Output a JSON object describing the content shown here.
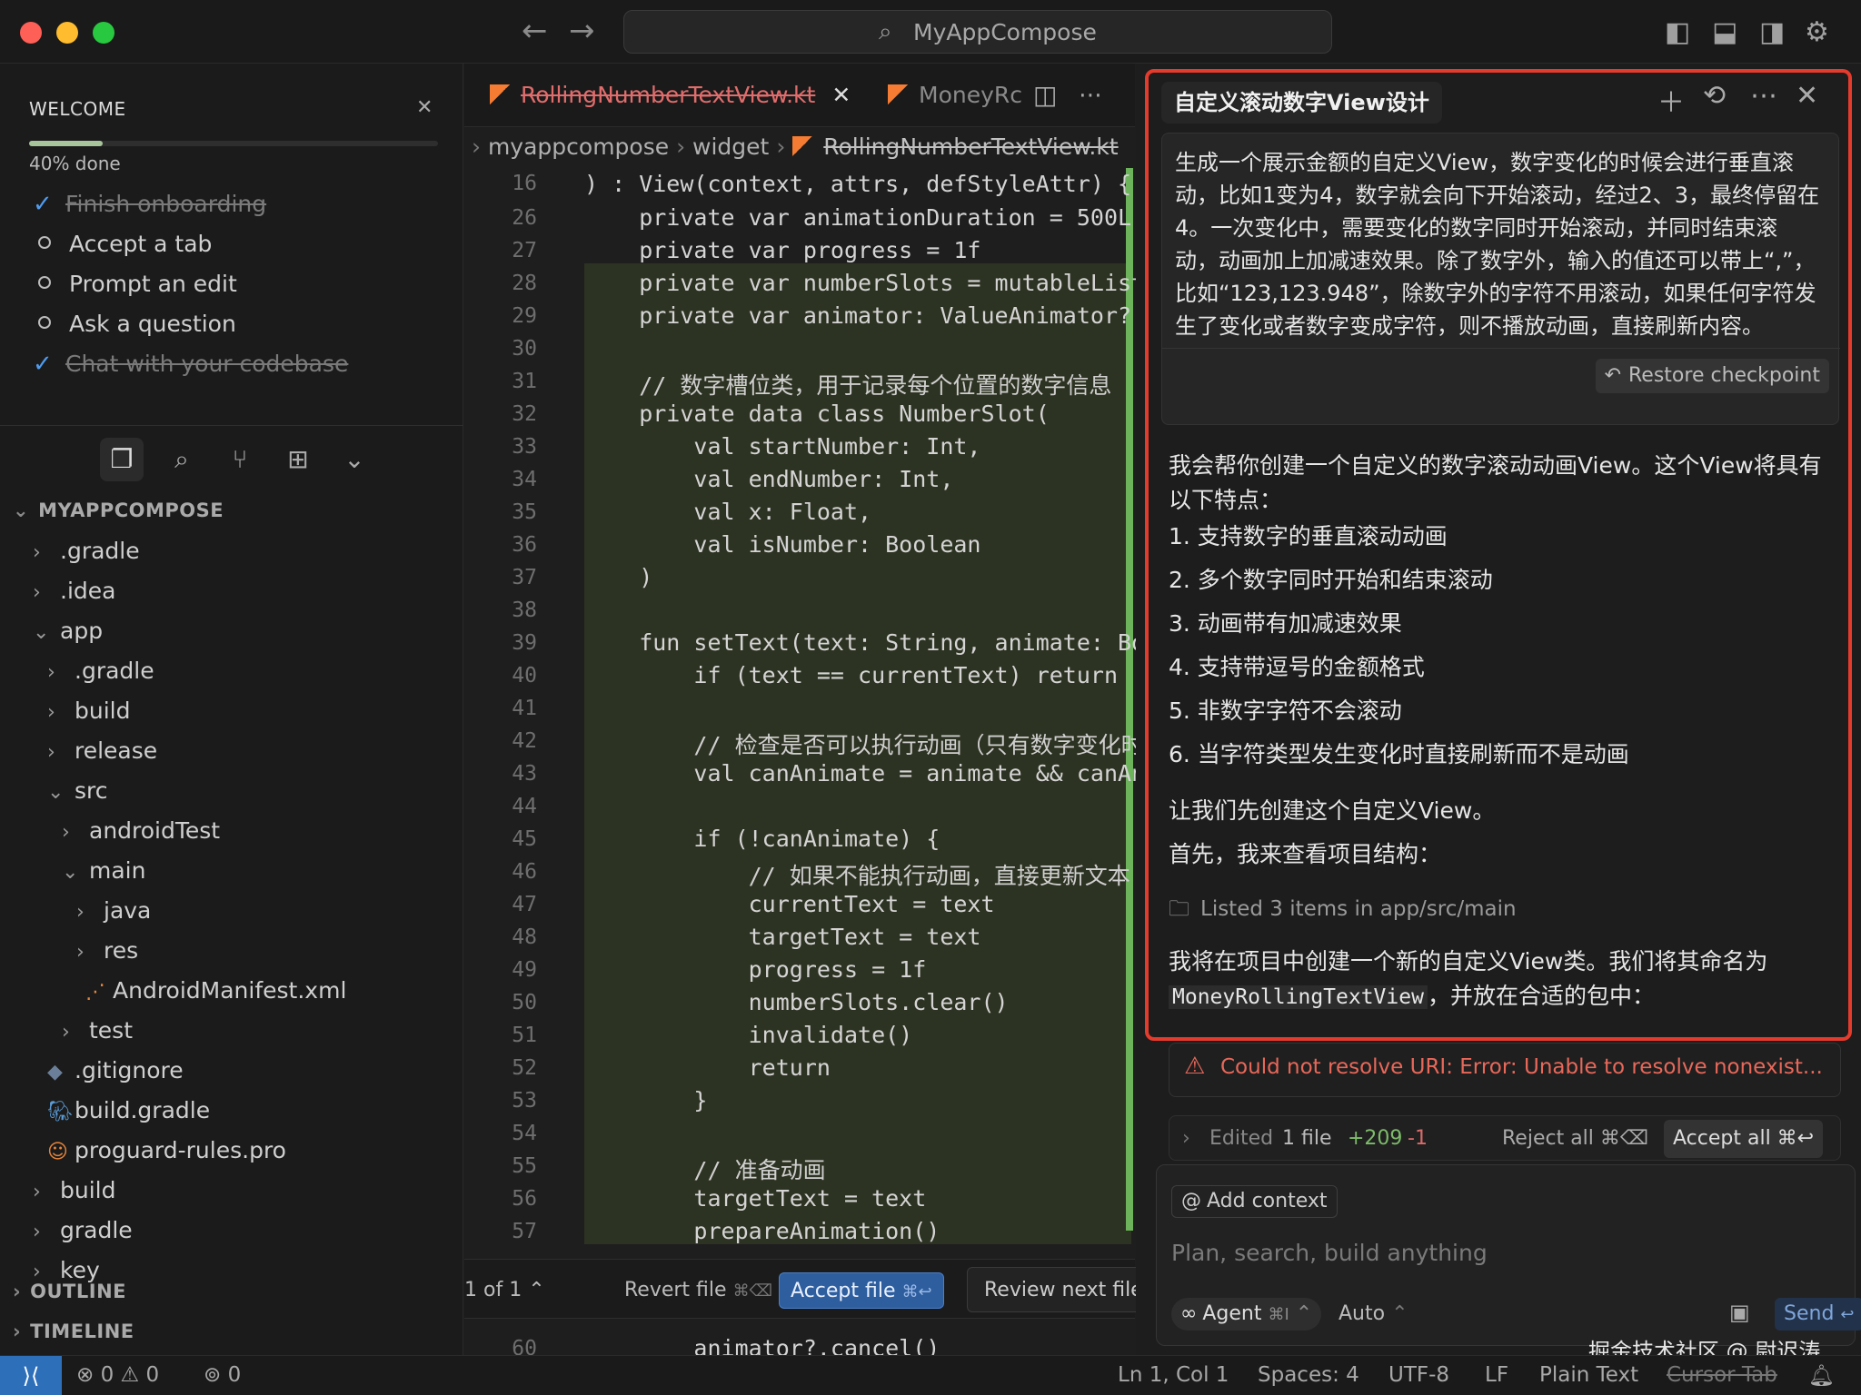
{
  "window": {
    "search": "MyAppCompose"
  },
  "welcome": {
    "title": "WELCOME",
    "progress_percent": 40,
    "progress_text": "40% done",
    "tasks": [
      {
        "label": "Finish onboarding",
        "done": true
      },
      {
        "label": "Accept a tab",
        "done": false
      },
      {
        "label": "Prompt an edit",
        "done": false
      },
      {
        "label": "Ask a question",
        "done": false
      },
      {
        "label": "Chat with your codebase",
        "done": true
      }
    ]
  },
  "explorer": {
    "root": "MYAPPCOMPOSE",
    "items": [
      ".gradle",
      ".idea",
      "app",
      ".gradle",
      "build",
      "release",
      "src",
      "androidTest",
      "main",
      "java",
      "res",
      "AndroidManifest.xml",
      "test",
      ".gitignore",
      "build.gradle",
      "proguard-rules.pro",
      "build",
      "gradle",
      "key"
    ],
    "outline": "OUTLINE",
    "timeline": "TIMELINE"
  },
  "editor": {
    "tabs": [
      "RollingNumberTextView.kt",
      "MoneyRc"
    ],
    "breadcrumb": [
      "myappcompose",
      "widget",
      "RollingNumberTextView.kt"
    ],
    "sticky": {
      "num": "16",
      "text": ") : View(context, attrs, defStyleAttr) {"
    },
    "lines": [
      {
        "num": "26",
        "text": "    private var animationDuration = 500L"
      },
      {
        "num": "27",
        "text": "    private var progress = 1f"
      },
      {
        "num": "28",
        "text": "    private var numberSlots = mutableList"
      },
      {
        "num": "29",
        "text": "    private var animator: ValueAnimator? ="
      },
      {
        "num": "30",
        "text": ""
      },
      {
        "num": "31",
        "text": "    // 数字槽位类，用于记录每个位置的数字信息"
      },
      {
        "num": "32",
        "text": "    private data class NumberSlot("
      },
      {
        "num": "33",
        "text": "        val startNumber: Int,"
      },
      {
        "num": "34",
        "text": "        val endNumber: Int,"
      },
      {
        "num": "35",
        "text": "        val x: Float,"
      },
      {
        "num": "36",
        "text": "        val isNumber: Boolean"
      },
      {
        "num": "37",
        "text": "    )"
      },
      {
        "num": "38",
        "text": ""
      },
      {
        "num": "39",
        "text": "    fun setText(text: String, animate: Boo"
      },
      {
        "num": "40",
        "text": "        if (text == currentText) return"
      },
      {
        "num": "41",
        "text": ""
      },
      {
        "num": "42",
        "text": "        // 检查是否可以执行动画（只有数字变化时"
      },
      {
        "num": "43",
        "text": "        val canAnimate = animate && canAni"
      },
      {
        "num": "44",
        "text": ""
      },
      {
        "num": "45",
        "text": "        if (!canAnimate) {"
      },
      {
        "num": "46",
        "text": "            // 如果不能执行动画，直接更新文本"
      },
      {
        "num": "47",
        "text": "            currentText = text"
      },
      {
        "num": "48",
        "text": "            targetText = text"
      },
      {
        "num": "49",
        "text": "            progress = 1f"
      },
      {
        "num": "50",
        "text": "            numberSlots.clear()"
      },
      {
        "num": "51",
        "text": "            invalidate()"
      },
      {
        "num": "52",
        "text": "            return"
      },
      {
        "num": "53",
        "text": "        }"
      },
      {
        "num": "54",
        "text": ""
      },
      {
        "num": "55",
        "text": "        // 准备动画"
      },
      {
        "num": "56",
        "text": "        targetText = text"
      },
      {
        "num": "57",
        "text": "        prepareAnimation()"
      }
    ],
    "last_line": {
      "num": "60",
      "text": "        animator?.cancel()"
    },
    "review": {
      "count": "1 of 1",
      "revert": "Revert file",
      "revert_kbd": "⌘⌫",
      "accept": "Accept file",
      "accept_kbd": "⌘↩",
      "next": "Review next file"
    }
  },
  "chat": {
    "title": "自定义滚动数字View设计",
    "user_message": "生成一个展示金额的自定义View，数字变化的时候会进行垂直滚动，比如1变为4，数字就会向下开始滚动，经过2、3，最终停留在4。一次变化中，需要变化的数字同时开始滚动，并同时结束滚动，动画加上加减速效果。除了数字外，输入的值还可以带上“,”，比如“123,123.948”，除数字外的字符不用滚动，如果任何字符发生了变化或者数字变成字符，则不播放动画，直接刷新内容。",
    "restore": "Restore checkpoint",
    "intro": "我会帮你创建一个自定义的数字滚动动画View。这个View将具有以下特点：",
    "features": [
      "1. 支持数字的垂直滚动动画",
      "2. 多个数字同时开始和结束滚动",
      "3. 动画带有加减速效果",
      "4. 支持带逗号的金额格式",
      "5. 非数字字符不会滚动",
      "6. 当字符类型发生变化时直接刷新而不是动画"
    ],
    "p1": "让我们先创建这个自定义View。",
    "p2": "首先，我来查看项目结构：",
    "listed": "Listed 3 items in app/src/main",
    "p3_a": "我将在项目中创建一个新的自定义View类。我们将其命名为",
    "p3_code": "MoneyRollingTextView",
    "p3_b": "，并放在合适的包中：",
    "error": "Could not resolve URI: Error: Unable to resolve nonexist...",
    "edited": {
      "label": "Edited",
      "files": "1 file",
      "added": "+209",
      "removed": "-1",
      "reject": "Reject all ⌘⌫",
      "accept": "Accept all ⌘↩"
    },
    "add_context": "Add context",
    "placeholder": "Plan, search, build anything",
    "agent": "Agent",
    "agent_kbd": "⌘I",
    "auto": "Auto",
    "send": "Send"
  },
  "watermark": "掘金技术社区 @ 尉迟涛",
  "status": {
    "errors": "0",
    "warnings": "0",
    "ports": "0",
    "position": "Ln 1, Col 1",
    "spaces": "Spaces: 4",
    "encoding": "UTF-8",
    "eol": "LF",
    "language": "Plain Text",
    "cursor_tab": "Cursor Tab"
  },
  "colors": {
    "accent": "#4f9cf0",
    "frame": "#e53b2c",
    "diff_added": "#6db35c",
    "error": "#e8685a"
  }
}
